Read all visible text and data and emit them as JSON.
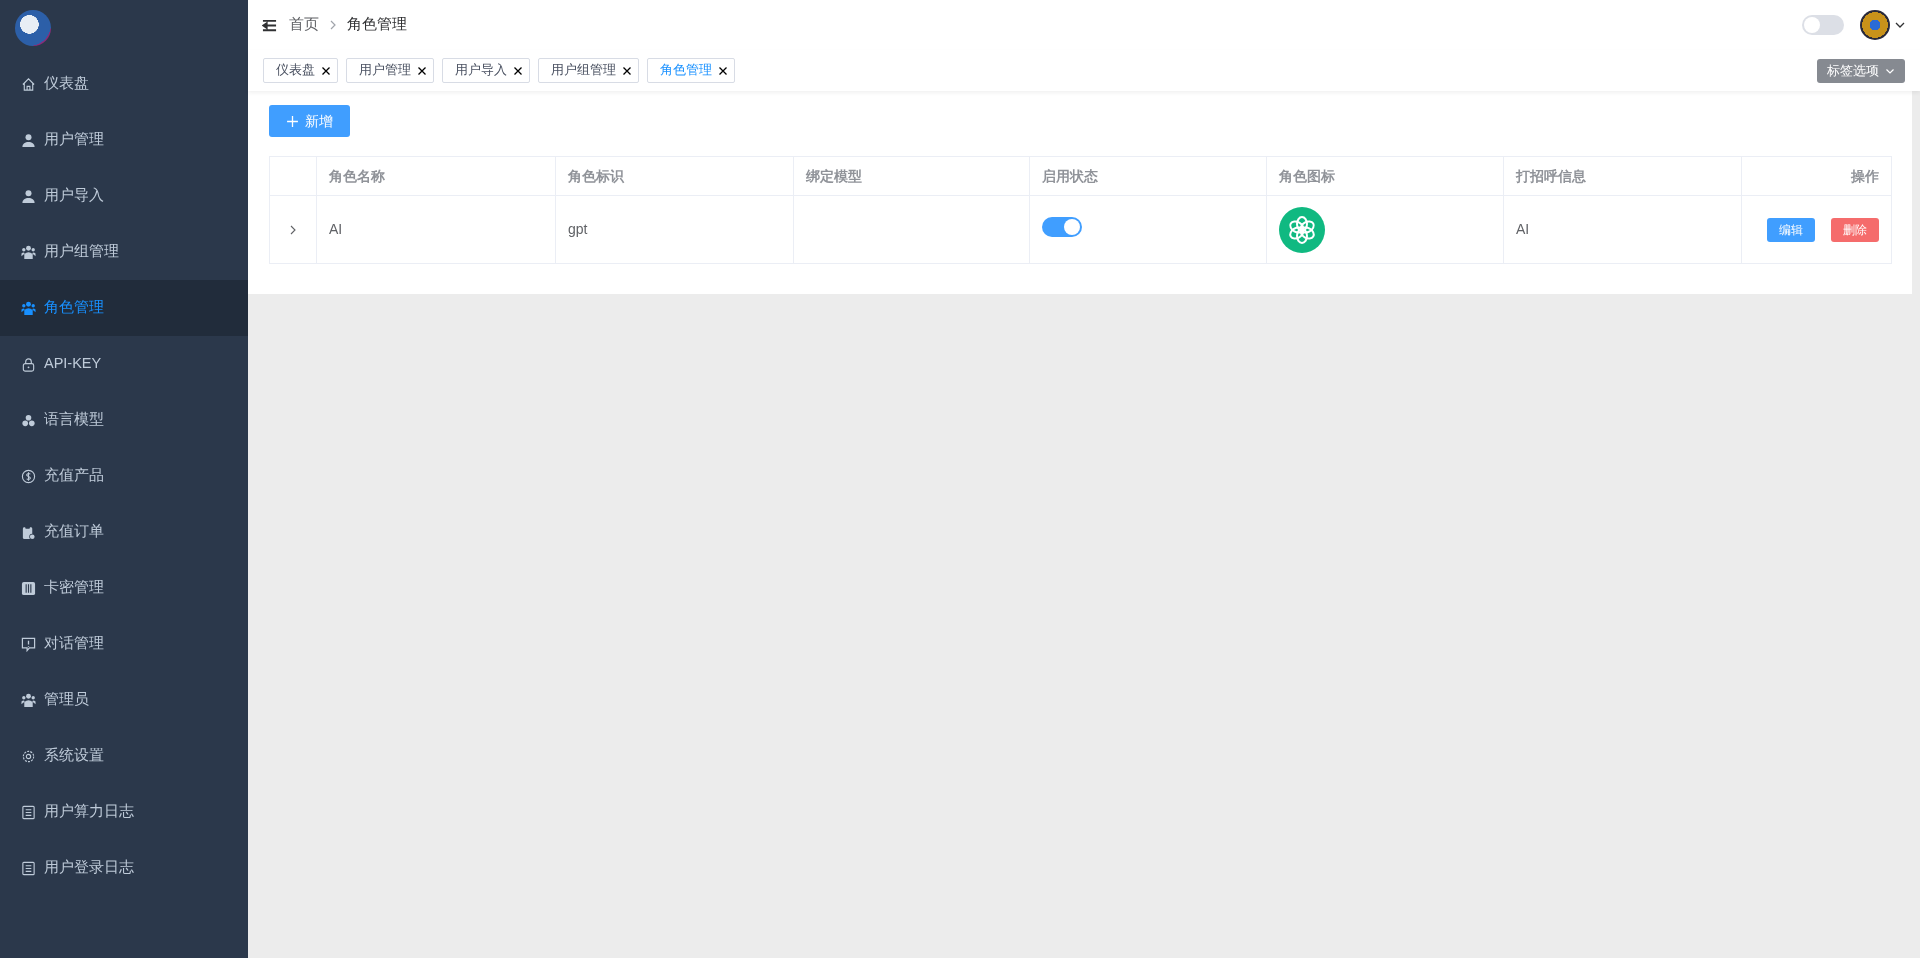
{
  "sidebar": {
    "items": [
      {
        "label": "仪表盘",
        "selected": false
      },
      {
        "label": "用户管理",
        "selected": false
      },
      {
        "label": "用户导入",
        "selected": false
      },
      {
        "label": "用户组管理",
        "selected": false
      },
      {
        "label": "角色管理",
        "selected": true
      },
      {
        "label": "API-KEY",
        "selected": false
      },
      {
        "label": "语言模型",
        "selected": false
      },
      {
        "label": "充值产品",
        "selected": false
      },
      {
        "label": "充值订单",
        "selected": false
      },
      {
        "label": "卡密管理",
        "selected": false
      },
      {
        "label": "对话管理",
        "selected": false
      },
      {
        "label": "管理员",
        "selected": false
      },
      {
        "label": "系统设置",
        "selected": false
      },
      {
        "label": "用户算力日志",
        "selected": false
      },
      {
        "label": "用户登录日志",
        "selected": false
      }
    ]
  },
  "header": {
    "breadcrumb": [
      "首页",
      "角色管理"
    ],
    "theme_toggle": {
      "on": false
    }
  },
  "tabs": [
    {
      "label": "仪表盘",
      "selected": false
    },
    {
      "label": "用户管理",
      "selected": false
    },
    {
      "label": "用户导入",
      "selected": false
    },
    {
      "label": "用户组管理",
      "selected": false
    },
    {
      "label": "角色管理",
      "selected": true
    }
  ],
  "tab_options": "标签选项",
  "add_button": "新增",
  "table": {
    "columns": [
      "角色名称",
      "角色标识",
      "绑定模型",
      "启用状态",
      "角色图标",
      "打招呼信息",
      "操作"
    ],
    "rows": [
      {
        "expanded": false,
        "name": "AI",
        "key": "gpt",
        "enabled": true,
        "greeting": "AI",
        "actions": [
          "编辑",
          "删除"
        ]
      }
    ]
  }
}
